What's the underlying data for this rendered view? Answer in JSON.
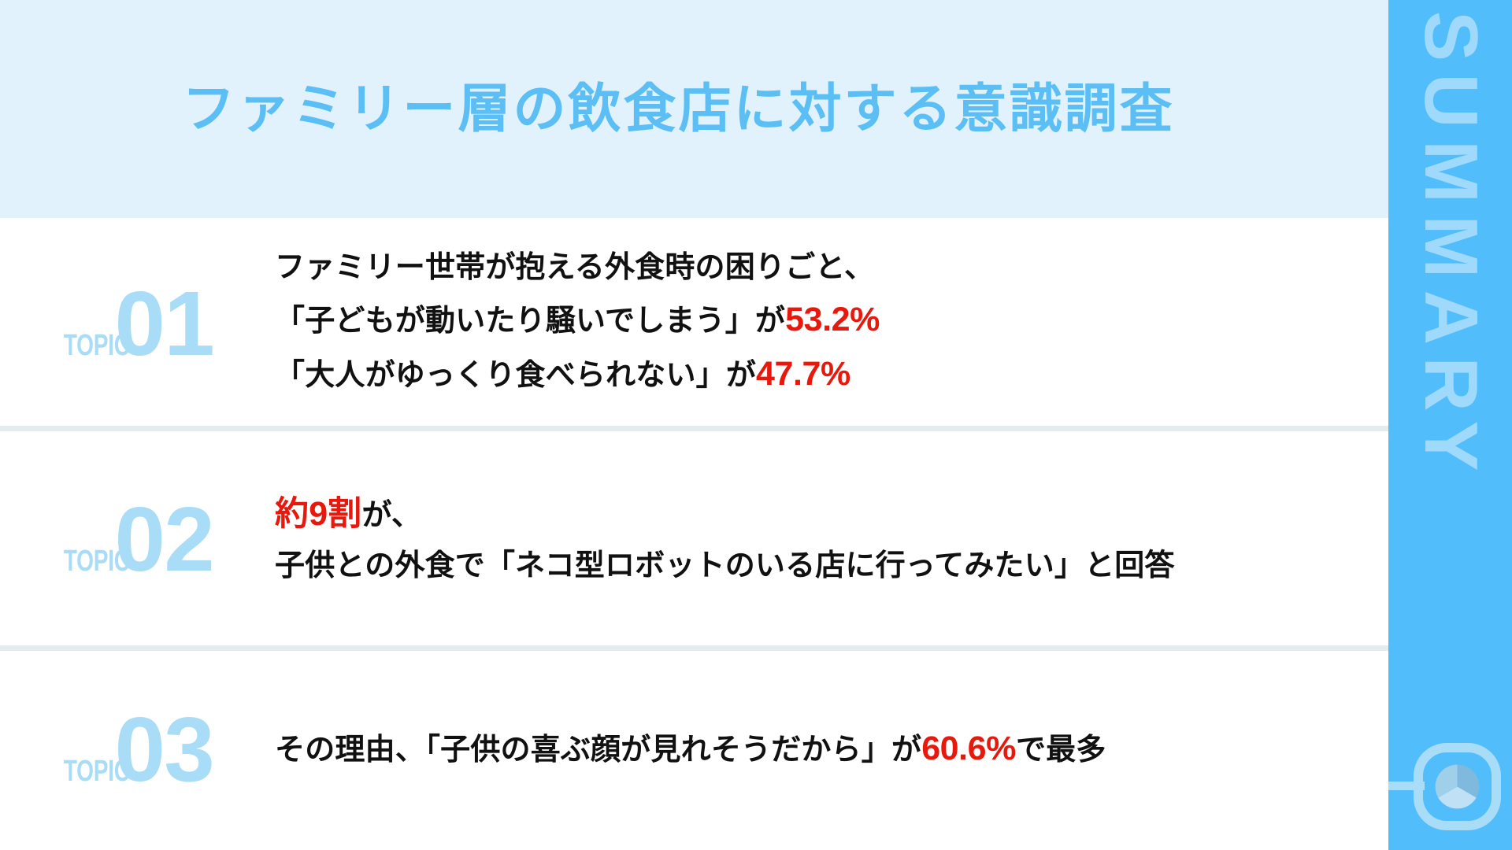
{
  "header": {
    "title": "ファミリー層の飲食店に対する意識調査",
    "background_color": "#e1f2fc",
    "title_color": "#5bbff5"
  },
  "sidebar": {
    "label": "SUMMARY",
    "background_color": "#52bdfb",
    "label_color": "#9fd9fb",
    "logo_icon": "pie-chart-logo-icon"
  },
  "topics": [
    {
      "label": "TOPIC",
      "number": "01",
      "lines": [
        {
          "parts": [
            {
              "text": "ファミリー世帯が抱える外食時の困りごと、",
              "style": "normal"
            }
          ]
        },
        {
          "parts": [
            {
              "text": "「子どもが動いたり騒いでしまう」が",
              "style": "normal"
            },
            {
              "text": "53.2%",
              "style": "percent"
            }
          ]
        },
        {
          "parts": [
            {
              "text": "「大人がゆっくり食べられない」が",
              "style": "normal"
            },
            {
              "text": "47.7%",
              "style": "percent"
            }
          ]
        }
      ]
    },
    {
      "label": "TOPIC",
      "number": "02",
      "lines": [
        {
          "parts": [
            {
              "text": "約9割",
              "style": "big-red"
            },
            {
              "text": "が、",
              "style": "normal"
            }
          ]
        },
        {
          "parts": [
            {
              "text": "子供との外食で「ネコ型ロボットのいる店に行ってみたい」と回答",
              "style": "normal"
            }
          ]
        }
      ]
    },
    {
      "label": "TOPIC",
      "number": "03",
      "lines": [
        {
          "parts": [
            {
              "text": "その理由、「子供の喜ぶ顔が見れそうだから」が",
              "style": "normal"
            },
            {
              "text": "60.6%",
              "style": "percent"
            },
            {
              "text": "で最多",
              "style": "normal"
            }
          ]
        }
      ]
    }
  ],
  "colors": {
    "accent_blue": "#52bdfb",
    "light_blue": "#a9dcf7",
    "header_bg": "#e1f2fc",
    "highlight_red": "#e8190c",
    "divider": "#e3ecef",
    "text": "#111111"
  },
  "survey_figures": {
    "topic01_issue1_label": "子どもが動いたり騒いでしまう",
    "topic01_issue1_value": "53.2%",
    "topic01_issue2_label": "大人がゆっくり食べられない",
    "topic01_issue2_value": "47.7%",
    "topic02_value": "約9割",
    "topic03_reason_label": "子供の喜ぶ顔が見れそうだから",
    "topic03_reason_value": "60.6%"
  }
}
